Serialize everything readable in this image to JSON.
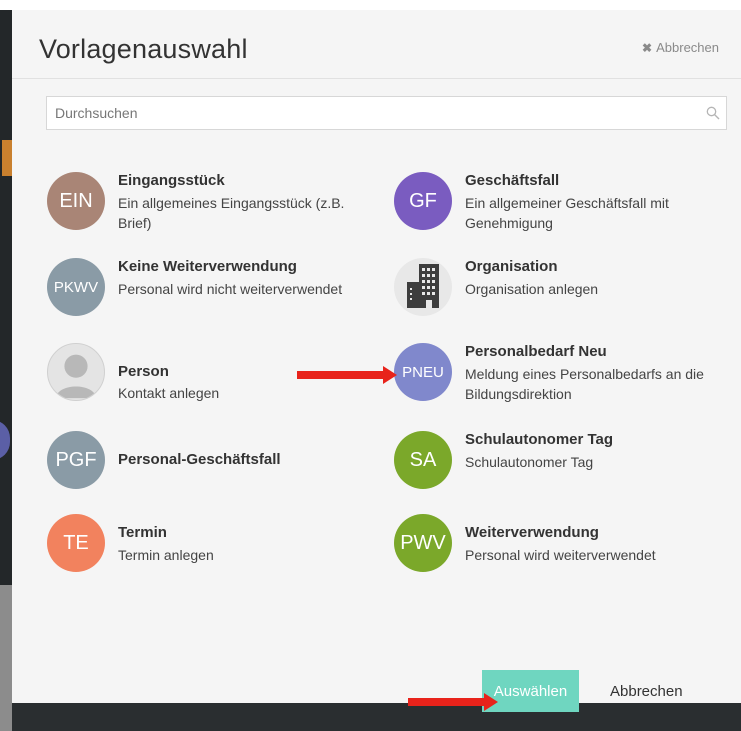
{
  "dialog": {
    "title": "Vorlagenauswahl",
    "close_label": "Abbrechen",
    "search": {
      "placeholder": "Durchsuchen",
      "value": ""
    },
    "templates": [
      {
        "key": "eingangsstueck",
        "badge": "EIN",
        "color": "#a98576",
        "title": "Eingangsstück",
        "description": "Ein allgemeines Eingangsstück (z.B. Brief)"
      },
      {
        "key": "geschaeftsfall",
        "badge": "GF",
        "color": "#7a5cc0",
        "title": "Geschäftsfall",
        "description": "Ein allgemeiner Geschäftsfall mit Genehmigung"
      },
      {
        "key": "keine-weiterverwendung",
        "badge": "PKWV",
        "color": "#8a9ba6",
        "title": "Keine Weiterverwendung",
        "description": "Personal wird nicht weiterverwendet"
      },
      {
        "key": "organisation",
        "badge": "",
        "icon": "building-icon",
        "color": "#e8e8e8",
        "title": "Organisation",
        "description": "Organisation anlegen"
      },
      {
        "key": "person",
        "badge": "",
        "icon": "person-silhouette-icon",
        "color": "#d4d4d4",
        "title": "Person",
        "description": "Kontakt anlegen"
      },
      {
        "key": "personalbedarf-neu",
        "badge": "PNEU",
        "color": "#8088cc",
        "title": "Personalbedarf Neu",
        "description": "Meldung eines Personalbedarfs an die Bildungsdirektion"
      },
      {
        "key": "personal-geschaeftsfall",
        "badge": "PGF",
        "color": "#8a9ba6",
        "title": "Personal-Geschäftsfall",
        "description": ""
      },
      {
        "key": "schulautonomer-tag",
        "badge": "SA",
        "color": "#7ba82a",
        "title": "Schulautonomer Tag",
        "description": "Schulautonomer Tag"
      },
      {
        "key": "termin",
        "badge": "TE",
        "color": "#f2825e",
        "title": "Termin",
        "description": "Termin anlegen"
      },
      {
        "key": "weiterverwendung",
        "badge": "PWV",
        "color": "#7ba82a",
        "title": "Weiterverwendung",
        "description": "Personal wird weiterverwendet"
      }
    ],
    "footer": {
      "select_label": "Auswählen",
      "cancel_label": "Abbrechen"
    }
  },
  "annotation_color": "#e8231b"
}
